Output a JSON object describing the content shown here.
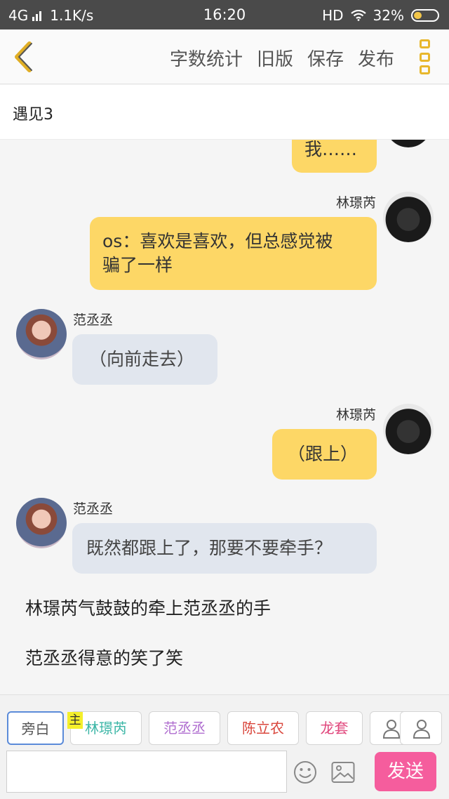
{
  "status_bar": {
    "network": "4G",
    "speed": "1.1K/s",
    "time": "16:20",
    "hd": "HD",
    "battery": "32%"
  },
  "nav": {
    "actions": [
      "字数统计",
      "旧版",
      "保存",
      "发布"
    ]
  },
  "chapter": {
    "title": "遇见3"
  },
  "messages": [
    {
      "speaker": "",
      "text": "我……",
      "side": "right"
    },
    {
      "speaker": "林璟芮",
      "text_line1": "os：喜欢是喜欢，但总感觉被",
      "text_line2": "骗了一样",
      "side": "right"
    },
    {
      "speaker": "范丞丞",
      "text": "（向前走去）",
      "side": "left"
    },
    {
      "speaker": "林璟芮",
      "text": "（跟上）",
      "side": "right"
    },
    {
      "speaker": "范丞丞",
      "text": "既然都跟上了，那要不要牵手？",
      "side": "left"
    }
  ],
  "narration": [
    "林璟芮气鼓鼓的牵上范丞丞的手",
    "范丞丞得意的笑了笑"
  ],
  "roles": {
    "narrator": "旁白",
    "main_tag": "主",
    "items": [
      {
        "label": "林璟芮",
        "color": "#3bb6a6"
      },
      {
        "label": "范丞丞",
        "color": "#b06fd0"
      },
      {
        "label": "陈立农",
        "color": "#d9463c"
      },
      {
        "label": "龙套",
        "color": "#e0457b"
      }
    ]
  },
  "composer": {
    "input_value": "",
    "send_label": "发送"
  },
  "colors": {
    "self_bubble": "#fdd766",
    "other_bubble": "#e1e6ee",
    "send_button": "#f55d9d",
    "accent": "#e8b72c"
  }
}
